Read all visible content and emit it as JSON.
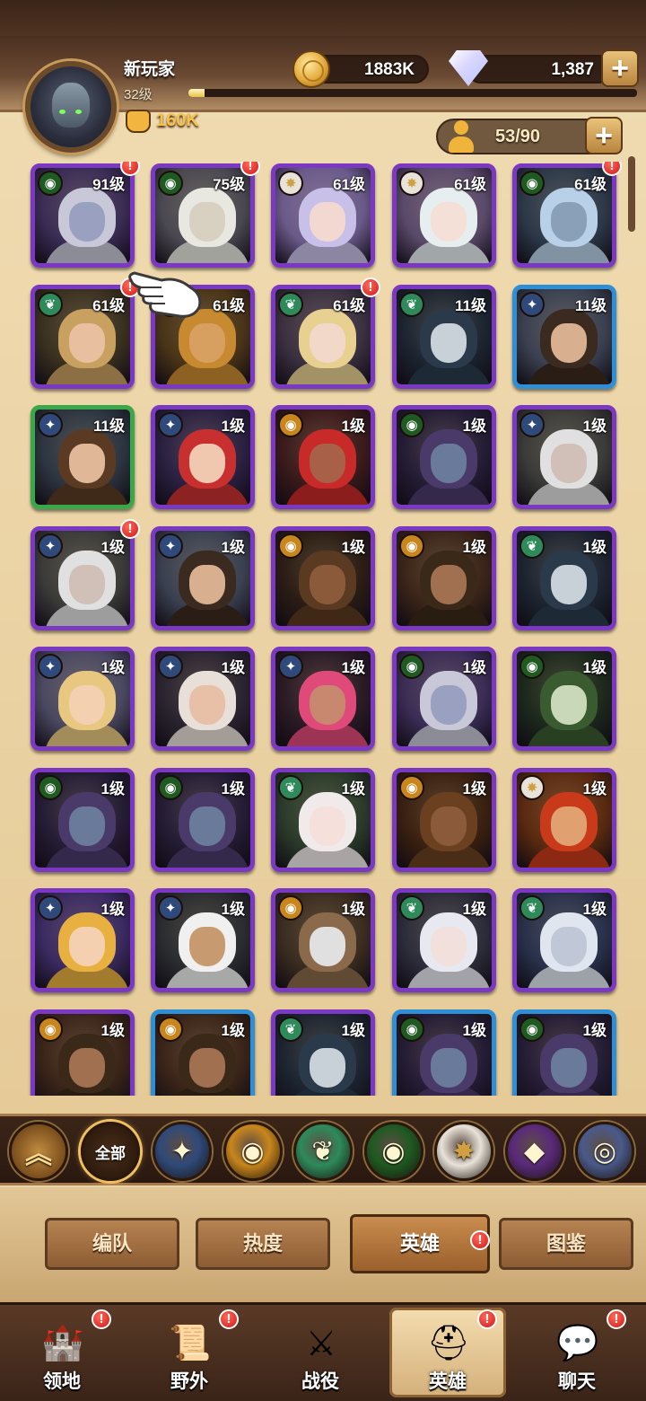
{
  "player": {
    "name": "新玩家",
    "level": "32级",
    "xp_progress": 0.035,
    "power": "160K",
    "power_icon": "fist-icon"
  },
  "currency": {
    "gold": "1883K",
    "gems": "1,387",
    "gold_icon": "gold-coin-icon",
    "gem_icon": "diamond-icon"
  },
  "roster": {
    "count": "53/90",
    "icon": "person-icon"
  },
  "heroes": [
    {
      "level": "91级",
      "faction": "graveborn",
      "frame": "purple",
      "alert": true,
      "skin": "#9aa0c0",
      "hair": "#c8c8d8",
      "bg": "#3a2c54"
    },
    {
      "level": "75级",
      "faction": "graveborn",
      "frame": "purple",
      "alert": true,
      "skin": "#d8d0c0",
      "hair": "#e8e8e0",
      "bg": "#4a4850"
    },
    {
      "level": "61级",
      "faction": "celestial",
      "frame": "purple",
      "alert": false,
      "skin": "#f2d8d0",
      "hair": "#c8c0e8",
      "bg": "#6a5a8a"
    },
    {
      "level": "61级",
      "faction": "celestial",
      "frame": "purple",
      "alert": false,
      "skin": "#f5e0d8",
      "hair": "#e6eef0",
      "bg": "#5a4a6a"
    },
    {
      "level": "61级",
      "faction": "graveborn",
      "frame": "purple",
      "alert": true,
      "skin": "#8aa0b8",
      "hair": "#b8d0e8",
      "bg": "#2c3848"
    },
    {
      "level": "61级",
      "faction": "wilder",
      "frame": "purple",
      "alert": true,
      "skin": "#e8c0a0",
      "hair": "#c8a060",
      "bg": "#3a3020"
    },
    {
      "level": "61级",
      "faction": "wilder",
      "frame": "purple",
      "alert": false,
      "skin": "#d8a060",
      "hair": "#c88a30",
      "bg": "#4a3418"
    },
    {
      "level": "61级",
      "faction": "wilder",
      "frame": "purple",
      "alert": true,
      "skin": "#f2d8c8",
      "hair": "#e8d090",
      "bg": "#3a3040"
    },
    {
      "level": "11级",
      "faction": "wilder",
      "frame": "purple",
      "alert": false,
      "skin": "#c8d0d8",
      "hair": "#2a3a4a",
      "bg": "#1c2430"
    },
    {
      "level": "11级",
      "faction": "lightbearer",
      "frame": "blue",
      "alert": false,
      "skin": "#d8b090",
      "hair": "#3a2a20",
      "bg": "#3a4050"
    },
    {
      "level": "11级",
      "faction": "lightbearer",
      "frame": "green",
      "alert": false,
      "skin": "#e0b898",
      "hair": "#5a3a22",
      "bg": "#2c3440"
    },
    {
      "level": "1级",
      "faction": "lightbearer",
      "frame": "purple",
      "alert": false,
      "skin": "#f0c8b0",
      "hair": "#c83030",
      "bg": "#2a2040"
    },
    {
      "level": "1级",
      "faction": "mauler",
      "frame": "purple",
      "alert": false,
      "skin": "#a86048",
      "hair": "#c82a2a",
      "bg": "#3a1a1a"
    },
    {
      "level": "1级",
      "faction": "graveborn",
      "frame": "purple",
      "alert": false,
      "skin": "#6a7a9a",
      "hair": "#4a3a6a",
      "bg": "#241c34"
    },
    {
      "level": "1级",
      "faction": "lightbearer",
      "frame": "purple",
      "alert": false,
      "skin": "#d0c0b8",
      "hair": "#e0e0e0",
      "bg": "#3a3a38"
    },
    {
      "level": "1级",
      "faction": "lightbearer",
      "frame": "purple",
      "alert": true,
      "skin": "#d0c0b8",
      "hair": "#e0e0e0",
      "bg": "#3a3a38"
    },
    {
      "level": "1级",
      "faction": "lightbearer",
      "frame": "purple",
      "alert": false,
      "skin": "#d8b090",
      "hair": "#3a2a20",
      "bg": "#3a4050"
    },
    {
      "level": "1级",
      "faction": "mauler",
      "frame": "purple",
      "alert": false,
      "skin": "#8a5a3a",
      "hair": "#5a3a20",
      "bg": "#2a1c14"
    },
    {
      "level": "1级",
      "faction": "mauler",
      "frame": "purple",
      "alert": false,
      "skin": "#a07050",
      "hair": "#3a2818",
      "bg": "#3a2418"
    },
    {
      "level": "1级",
      "faction": "wilder",
      "frame": "purple",
      "alert": false,
      "skin": "#c8d0d8",
      "hair": "#2a3a4a",
      "bg": "#1c2430"
    },
    {
      "level": "1级",
      "faction": "lightbearer",
      "frame": "purple",
      "alert": false,
      "skin": "#f2d0b0",
      "hair": "#e8c880",
      "bg": "#4a4860"
    },
    {
      "level": "1级",
      "faction": "lightbearer",
      "frame": "purple",
      "alert": false,
      "skin": "#e8c0a8",
      "hair": "#e8e0d8",
      "bg": "#2a2430"
    },
    {
      "level": "1级",
      "faction": "lightbearer",
      "frame": "purple",
      "alert": false,
      "skin": "#c88870",
      "hair": "#e04a7a",
      "bg": "#2a1a24"
    },
    {
      "level": "1级",
      "faction": "graveborn",
      "frame": "purple",
      "alert": false,
      "skin": "#9aa0c0",
      "hair": "#c8c8d8",
      "bg": "#3a2c54"
    },
    {
      "level": "1级",
      "faction": "graveborn",
      "frame": "purple",
      "alert": false,
      "skin": "#c8d8b8",
      "hair": "#3a5a30",
      "bg": "#1c281c"
    },
    {
      "level": "1级",
      "faction": "graveborn",
      "frame": "purple",
      "alert": false,
      "skin": "#6a7a9a",
      "hair": "#4a3a6a",
      "bg": "#241c34"
    },
    {
      "level": "1级",
      "faction": "graveborn",
      "frame": "purple",
      "alert": false,
      "skin": "#6a7a9a",
      "hair": "#4a3a6a",
      "bg": "#241c34"
    },
    {
      "level": "1级",
      "faction": "wilder",
      "frame": "purple",
      "alert": false,
      "skin": "#f5e0dc",
      "hair": "#f0eaea",
      "bg": "#2a3a2a"
    },
    {
      "level": "1级",
      "faction": "mauler",
      "frame": "purple",
      "alert": false,
      "skin": "#8a5a3a",
      "hair": "#6a4020",
      "bg": "#3a2010"
    },
    {
      "level": "1级",
      "faction": "celestial",
      "frame": "purple",
      "alert": false,
      "skin": "#e0a070",
      "hair": "#c83a1a",
      "bg": "#5a2a10"
    },
    {
      "level": "1级",
      "faction": "lightbearer",
      "frame": "purple",
      "alert": false,
      "skin": "#f5d0b0",
      "hair": "#e8b040",
      "bg": "#3a2a60"
    },
    {
      "level": "1级",
      "faction": "lightbearer",
      "frame": "purple",
      "alert": false,
      "skin": "#c89a70",
      "hair": "#f0f0f0",
      "bg": "#2a2c30"
    },
    {
      "level": "1级",
      "faction": "mauler",
      "frame": "purple",
      "alert": false,
      "skin": "#e0e0e0",
      "hair": "#8a6a4a",
      "bg": "#3a2c20"
    },
    {
      "level": "1级",
      "faction": "wilder",
      "frame": "purple",
      "alert": false,
      "skin": "#f2e0dc",
      "hair": "#e8e8f0",
      "bg": "#2c2c3a"
    },
    {
      "level": "1级",
      "faction": "wilder",
      "frame": "purple",
      "alert": false,
      "skin": "#c0c8d8",
      "hair": "#e0e6f0",
      "bg": "#28304a"
    },
    {
      "level": "1级",
      "faction": "mauler",
      "frame": "purple",
      "alert": false,
      "skin": "#a07050",
      "hair": "#3a2818",
      "bg": "#3a2418"
    },
    {
      "level": "1级",
      "faction": "mauler",
      "frame": "blue",
      "alert": false,
      "skin": "#a07050",
      "hair": "#3a2818",
      "bg": "#3a2418"
    },
    {
      "level": "1级",
      "faction": "wilder",
      "frame": "purple",
      "alert": false,
      "skin": "#c8d0d8",
      "hair": "#2a3a4a",
      "bg": "#1c2430"
    },
    {
      "level": "1级",
      "faction": "graveborn",
      "frame": "blue",
      "alert": false,
      "skin": "#6a7a9a",
      "hair": "#4a3a6a",
      "bg": "#241c34"
    },
    {
      "level": "1级",
      "faction": "graveborn",
      "frame": "blue",
      "alert": false,
      "skin": "#6a7a9a",
      "hair": "#4a3a6a",
      "bg": "#241c34"
    }
  ],
  "factions": {
    "lightbearer": {
      "color": "#2f4a7a",
      "glyph": "✦"
    },
    "mauler": {
      "color": "#c8861c",
      "glyph": "◉"
    },
    "wilder": {
      "color": "#2e8a5a",
      "glyph": "❦"
    },
    "graveborn": {
      "color": "#1f5a22",
      "glyph": "◉"
    },
    "celestial": {
      "color": "#e8e2d8",
      "glyph": "✸"
    },
    "hypogean": {
      "color": "#5a2a7a",
      "glyph": "◆"
    },
    "dimensional": {
      "color": "#4a5a8a",
      "glyph": "◎"
    }
  },
  "filters": {
    "collapse_icon": "double-chevron-up-icon",
    "all_label": "全部",
    "items": [
      "lightbearer",
      "mauler",
      "wilder",
      "graveborn",
      "celestial",
      "hypogean",
      "dimensional"
    ]
  },
  "subtabs": [
    {
      "label": "编队",
      "active": false,
      "alert": false
    },
    {
      "label": "热度",
      "active": false,
      "alert": false
    },
    {
      "label": "英雄",
      "active": true,
      "alert": true
    },
    {
      "label": "图鉴",
      "active": false,
      "alert": false
    }
  ],
  "nav": [
    {
      "label": "领地",
      "icon": "castle-icon",
      "glyph": "🏰",
      "active": false,
      "alert": true
    },
    {
      "label": "野外",
      "icon": "map-scroll-icon",
      "glyph": "📜",
      "active": false,
      "alert": true
    },
    {
      "label": "战役",
      "icon": "crossed-swords-icon",
      "glyph": "⚔",
      "active": false,
      "alert": false
    },
    {
      "label": "英雄",
      "icon": "helmet-icon",
      "glyph": "⛑",
      "active": true,
      "alert": true
    },
    {
      "label": "聊天",
      "icon": "chat-bubble-icon",
      "glyph": "💬",
      "active": false,
      "alert": true
    }
  ]
}
